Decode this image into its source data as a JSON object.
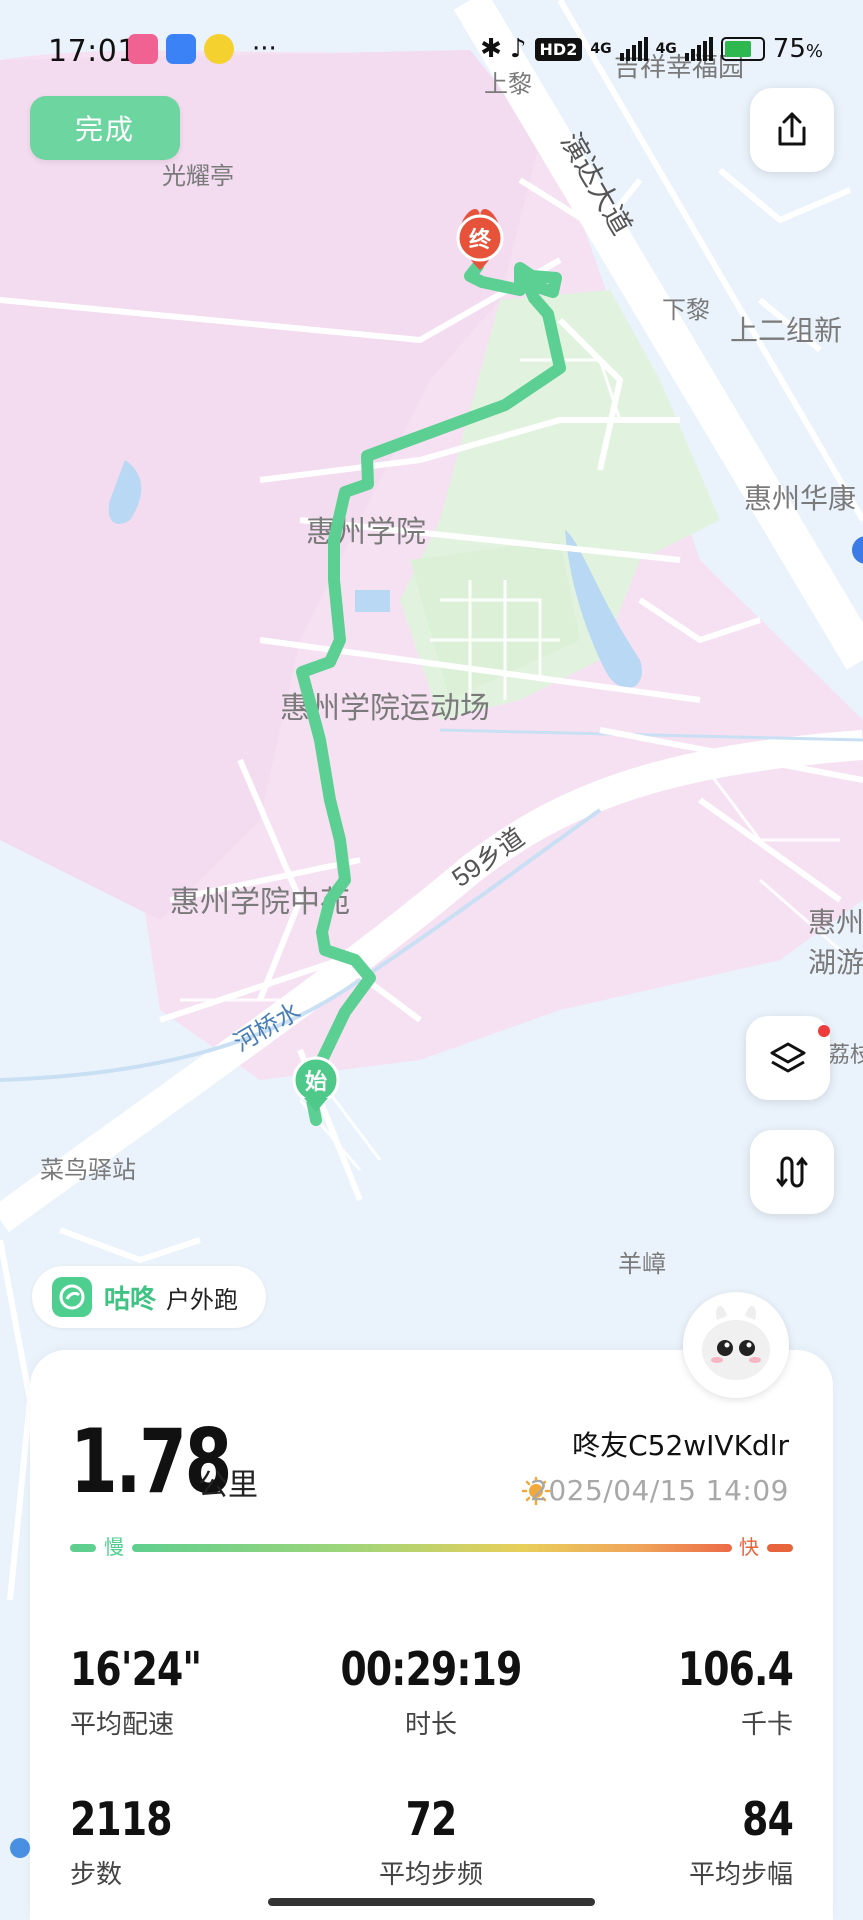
{
  "status_bar": {
    "time": "17:01",
    "more": "···",
    "network_labels": [
      "4G",
      "4G"
    ],
    "hd_label": "HD2",
    "battery": "75",
    "battery_unit": "%"
  },
  "header": {
    "done_label": "完成",
    "share_icon": "share-icon"
  },
  "map": {
    "labels": {
      "shangli": "上黎",
      "jixiang": "吉祥幸福园",
      "guangyao": "光耀亭",
      "yanda": "演达大道",
      "xiali": "下黎",
      "shanger": "上二组新",
      "huizhou_hua": "惠州华康",
      "hzxy": "惠州学院",
      "stadium": "惠州学院运动场",
      "road59": "59乡道",
      "zhongyuan": "惠州学院中苑",
      "heqiao": "河桥水",
      "huizhou_lake": "惠州",
      "lake2": "湖游",
      "cainiao": "菜鸟驿站",
      "yangzhang": "羊嶂",
      "li": "荔枝"
    },
    "start_marker": "始",
    "end_marker": "终",
    "route_color": "#5ccf92"
  },
  "brand": {
    "name": "咕咚",
    "activity": "户外跑"
  },
  "summary": {
    "distance": "1.78",
    "distance_unit": "公里",
    "user": "咚友C52wIVKdlr",
    "datetime": "2025/04/15 14:09",
    "slow_label": "慢",
    "fast_label": "快"
  },
  "stats": [
    {
      "value": "16'24\"",
      "label": "平均配速"
    },
    {
      "value": "00:29:19",
      "label": "时长"
    },
    {
      "value": "106.4",
      "label": "千卡"
    },
    {
      "value": "2118",
      "label": "步数"
    },
    {
      "value": "72",
      "label": "平均步频"
    },
    {
      "value": "84",
      "label": "平均步幅"
    }
  ]
}
